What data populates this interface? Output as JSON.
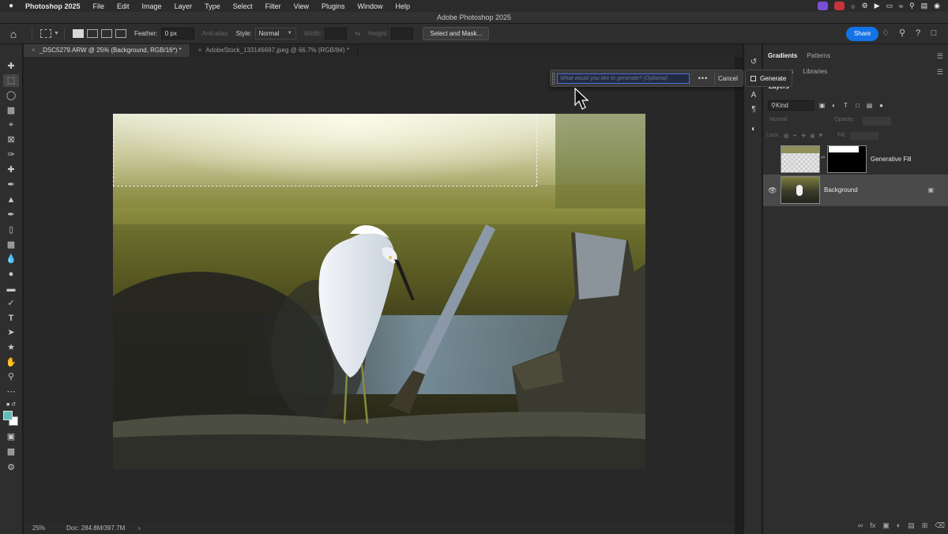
{
  "menubar": {
    "apple": "",
    "app": "Photoshop 2025",
    "items": [
      "File",
      "Edit",
      "Image",
      "Layer",
      "Type",
      "Select",
      "Filter",
      "View",
      "Plugins",
      "Window",
      "Help"
    ]
  },
  "titlebar": {
    "title": "Adobe Photoshop 2025"
  },
  "options": {
    "feather_label": "Feather:",
    "feather_value": "0 px",
    "antialias_label": "Anti-alias",
    "style_label": "Style:",
    "style_value": "Normal",
    "width_label": "Width:",
    "height_label": "Height:",
    "select_mask": "Select and Mask...",
    "share": "Share"
  },
  "tabs": [
    {
      "label": "_DSC5279.ARW @ 25% (Background, RGB/16*) *",
      "active": true
    },
    {
      "label": "AdobeStock_133146697.jpeg @ 66.7% (RGB/8#) *",
      "active": false
    }
  ],
  "taskbar": {
    "prompt_placeholder": "What would you like to generate? (Optional)",
    "more": "•••",
    "cancel": "Cancel",
    "generate": "Generate"
  },
  "status": {
    "zoom": "25%",
    "doc": "Doc: 284.8M/397.7M",
    "arrow": "›"
  },
  "panels": {
    "group1": [
      "Gradients",
      "Patterns"
    ],
    "group2_partial": "es",
    "group2": [
      "Libraries"
    ],
    "layers_title": "Layers",
    "filter_kind": "Kind",
    "blend_mode": "Normal",
    "opacity_label": "Opacity:",
    "lock_label": "Lock:",
    "fill_label": "Fill:",
    "layers": [
      {
        "name": "Generative Fill",
        "selected": false
      },
      {
        "name": "Background",
        "selected": true
      }
    ]
  },
  "colors": {
    "foreground": "#5fbcb6",
    "background": "#ffffff",
    "accent": "#1473e6"
  }
}
